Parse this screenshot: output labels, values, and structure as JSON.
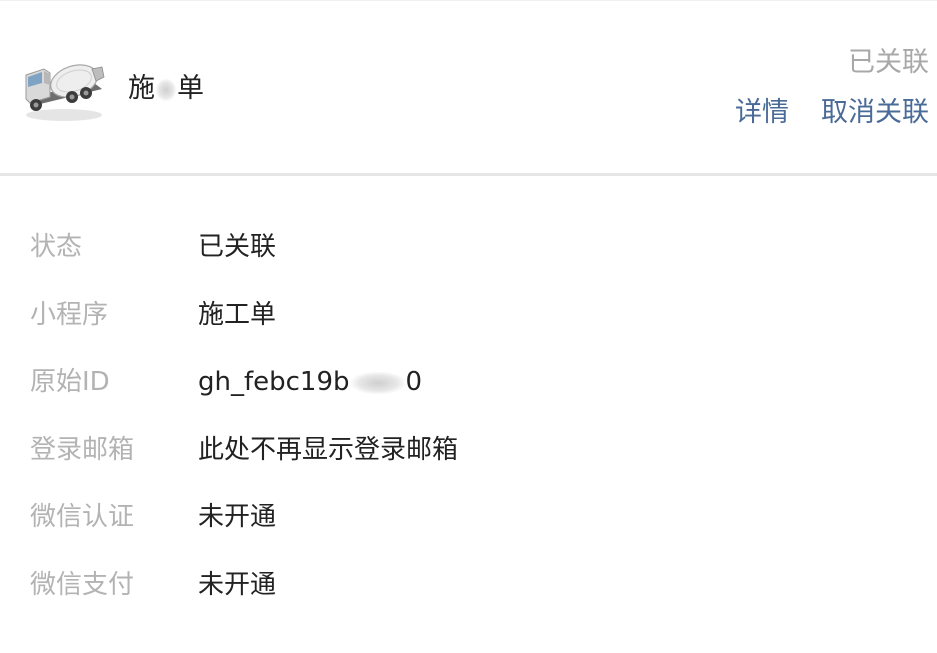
{
  "header": {
    "app_name_prefix": "施",
    "app_name_suffix": "单",
    "status": "已关联",
    "actions": {
      "details": "详情",
      "unlink": "取消关联"
    }
  },
  "info": {
    "rows": [
      {
        "label": "状态",
        "value": "已关联"
      },
      {
        "label": "小程序",
        "value": "施工单"
      },
      {
        "label": "原始ID",
        "value_prefix": "gh_f",
        "value_mid": "ebc19b",
        "value_suffix": "0"
      },
      {
        "label": "登录邮箱",
        "value": "此处不再显示登录邮箱"
      },
      {
        "label": "微信认证",
        "value": "未开通"
      },
      {
        "label": "微信支付",
        "value": "未开通"
      }
    ]
  },
  "icons": {
    "app_icon": "cement-mixer-truck-icon"
  }
}
